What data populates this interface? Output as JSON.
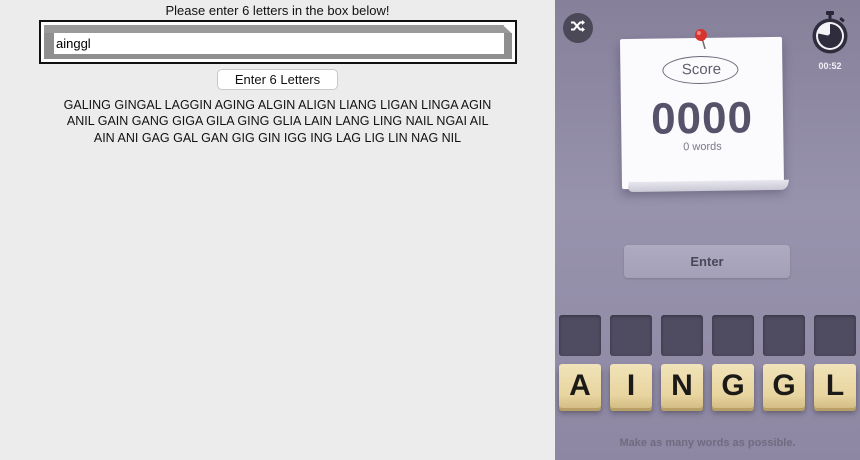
{
  "form": {
    "prompt": "Please enter 6 letters in the box below!",
    "input_value": "ainggl",
    "submit_label": "Enter 6 Letters"
  },
  "results": {
    "words": [
      "GALING",
      "GINGAL",
      "LAGGIN",
      "AGING",
      "ALGIN",
      "ALIGN",
      "LIANG",
      "LIGAN",
      "LINGA",
      "AGIN",
      "ANIL",
      "GAIN",
      "GANG",
      "GIGA",
      "GILA",
      "GING",
      "GLIA",
      "LAIN",
      "LANG",
      "LING",
      "NAIL",
      "NGAI",
      "AIL",
      "AIN",
      "ANI",
      "GAG",
      "GAL",
      "GAN",
      "GIG",
      "GIN",
      "IGG",
      "ING",
      "LAG",
      "LIG",
      "LIN",
      "NAG",
      "NIL"
    ]
  },
  "game": {
    "score_label": "Score",
    "score": "0000",
    "words_found": "0 words",
    "timer": "00:52",
    "enter_label": "Enter",
    "slot_count": 6,
    "tiles": [
      "A",
      "I",
      "N",
      "G",
      "G",
      "L"
    ],
    "hint": "Make as many words as possible.",
    "icons": {
      "shuffle": "shuffle-icon",
      "timer": "stopwatch-icon",
      "pin": "pushpin-icon"
    }
  }
}
